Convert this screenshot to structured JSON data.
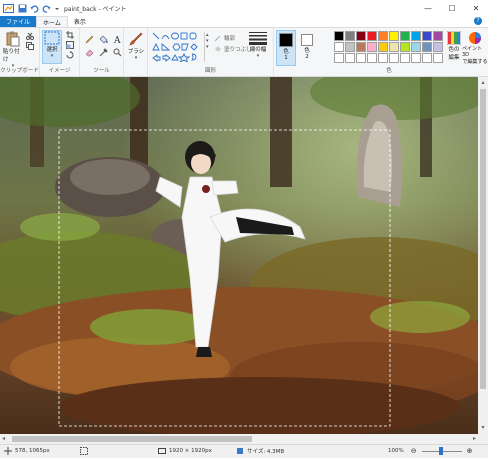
{
  "window": {
    "title": "paint_back - ペイント",
    "minimize": "—",
    "maximize": "☐",
    "close": "✕"
  },
  "tabs": [
    {
      "label": "ファイル"
    },
    {
      "label": "ホーム"
    },
    {
      "label": "表示"
    }
  ],
  "ribbon": {
    "clipboard": {
      "paste": "貼り付け",
      "label": "クリップボード"
    },
    "image": {
      "select": "選択",
      "label": "イメージ"
    },
    "tools": {
      "label": "ツール"
    },
    "brushes": {
      "label": "ブラシ"
    },
    "shapes": {
      "outline": "輪郭",
      "fill": "塗りつぶし",
      "label": "図形"
    },
    "size": {
      "label": "線の幅"
    },
    "color1": {
      "label": "色",
      "num": "1"
    },
    "color2": {
      "label": "色",
      "num": "2"
    },
    "edit_colors": {
      "line1": "色の",
      "line2": "編集"
    },
    "paint3d": {
      "line1": "ペイント 3D",
      "line2": "で編集する"
    },
    "colors_group_label": "色"
  },
  "palette": {
    "color1": "#000000",
    "color2": "#ffffff",
    "swatches": [
      "#000000",
      "#7f7f7f",
      "#880015",
      "#ed1c24",
      "#ff7f27",
      "#fff200",
      "#22b14c",
      "#00a2e8",
      "#3f48cc",
      "#a349a4",
      "#ffffff",
      "#c3c3c3",
      "#b97a57",
      "#ffaec9",
      "#ffc90e",
      "#efe4b0",
      "#b5e61d",
      "#99d9ea",
      "#7092be",
      "#c8bfe7",
      "#ffffff",
      "#ffffff",
      "#ffffff",
      "#ffffff",
      "#ffffff",
      "#ffffff",
      "#ffffff",
      "#ffffff",
      "#ffffff",
      "#ffffff"
    ]
  },
  "status": {
    "cursor": "578, 1065px",
    "image_size": "1920 × 1920px",
    "file_size": "サイズ: 4.3MB",
    "zoom": "100%"
  }
}
